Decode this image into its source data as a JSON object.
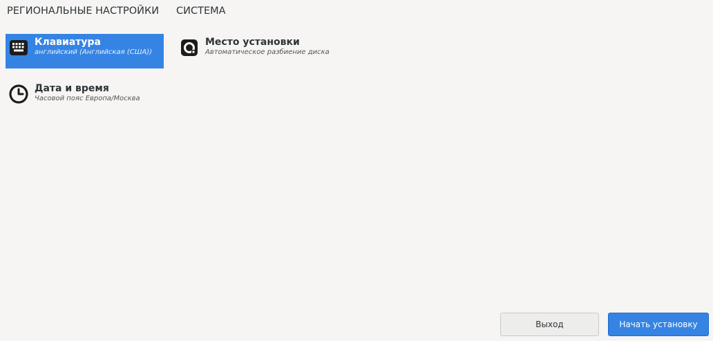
{
  "sections": {
    "regional": "РЕГИОНАЛЬНЫЕ НАСТРОЙКИ",
    "system": "СИСТЕМА"
  },
  "spokes": {
    "keyboard": {
      "name": "Клавиатура",
      "status": "английский (Английская (США))",
      "icon": "keyboard-icon",
      "selected": true
    },
    "datetime": {
      "name": "Дата и время",
      "status": "Часовой пояс Европа/Москва",
      "icon": "clock-icon"
    },
    "storage": {
      "name": "Место установки",
      "status": "Автоматическое разбиение диска",
      "icon": "disk-icon"
    }
  },
  "buttons": {
    "quit": "Выход",
    "begin": "Начать установку"
  },
  "colors": {
    "accent": "#3584e4",
    "background": "#f6f5f4"
  }
}
